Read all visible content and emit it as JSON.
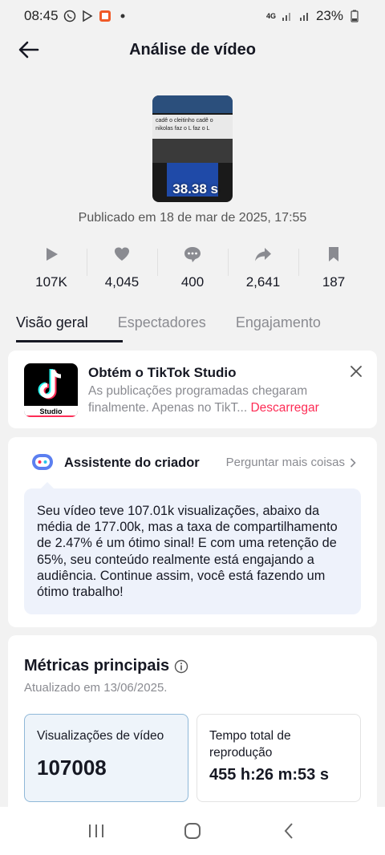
{
  "status_bar": {
    "time": "08:45",
    "network": "4G",
    "battery": "23%"
  },
  "header": {
    "title": "Análise de vídeo"
  },
  "video": {
    "caption_line1": "cadê o cleitinho  cadê  o",
    "caption_line2": "nikolas faz o L faz o L",
    "duration": "38.38 s",
    "published": "Publicado em 18 de mar de 2025, 17:55"
  },
  "stats": [
    {
      "icon": "play-icon",
      "value": "107K"
    },
    {
      "icon": "heart-icon",
      "value": "4,045"
    },
    {
      "icon": "comment-icon",
      "value": "400"
    },
    {
      "icon": "share-icon",
      "value": "2,641"
    },
    {
      "icon": "bookmark-icon",
      "value": "187"
    }
  ],
  "tabs": [
    {
      "label": "Visão geral",
      "active": true
    },
    {
      "label": "Espectadores",
      "active": false
    },
    {
      "label": "Engajamento",
      "active": false
    }
  ],
  "studio_promo": {
    "logo_label": "Studio",
    "title": "Obtém o TikTok Studio",
    "desc_line1": "As publicações programadas chegaram",
    "desc_line2": "finalmente. Apenas no TikT...",
    "download": "Descarregar"
  },
  "assistant": {
    "title": "Assistente do criador",
    "link": "Perguntar mais coisas",
    "message": "Seu vídeo teve 107.01k visualizações, abaixo da média de 177.00k, mas a taxa de compartilhamento de 2.47% é um ótimo sinal! E com uma retenção de 65%, seu conteúdo realmente está engajando a audiência. Continue assim, você está fazendo um ótimo trabalho!"
  },
  "metrics": {
    "title": "Métricas principais",
    "updated": "Atualizado em 13/06/2025.",
    "items": [
      {
        "label": "Visualizações de vídeo",
        "value": "107008"
      },
      {
        "label": "Tempo total de reprodução",
        "value": "455 h:26 m:53 s"
      }
    ]
  },
  "colors": {
    "accent": "#fe2c55",
    "text": "#161823",
    "muted": "#8a8b91",
    "bubble": "#eef2fb"
  }
}
